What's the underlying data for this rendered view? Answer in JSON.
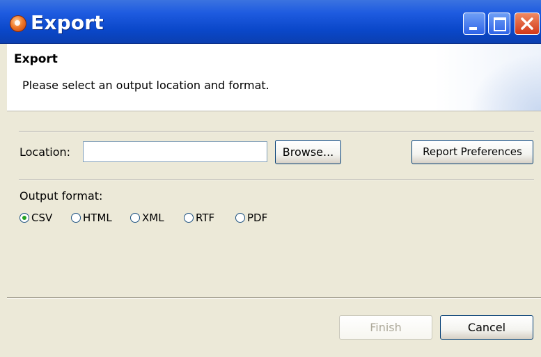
{
  "window": {
    "title": "Export"
  },
  "header": {
    "title": "Export",
    "description": "Please select an output location and format."
  },
  "location": {
    "label": "Location:",
    "value": "",
    "browse_label": "Browse...",
    "preferences_label": "Report Preferences"
  },
  "output": {
    "label": "Output format:",
    "options": [
      {
        "label": "CSV",
        "checked": true
      },
      {
        "label": "HTML",
        "checked": false
      },
      {
        "label": "XML",
        "checked": false
      },
      {
        "label": "RTF",
        "checked": false
      },
      {
        "label": "PDF",
        "checked": false
      }
    ]
  },
  "footer": {
    "finish_label": "Finish",
    "cancel_label": "Cancel"
  },
  "colors": {
    "titlebar": "#0a47c9",
    "dialog_bg": "#ece9d8",
    "radio_checked": "#21a121"
  }
}
